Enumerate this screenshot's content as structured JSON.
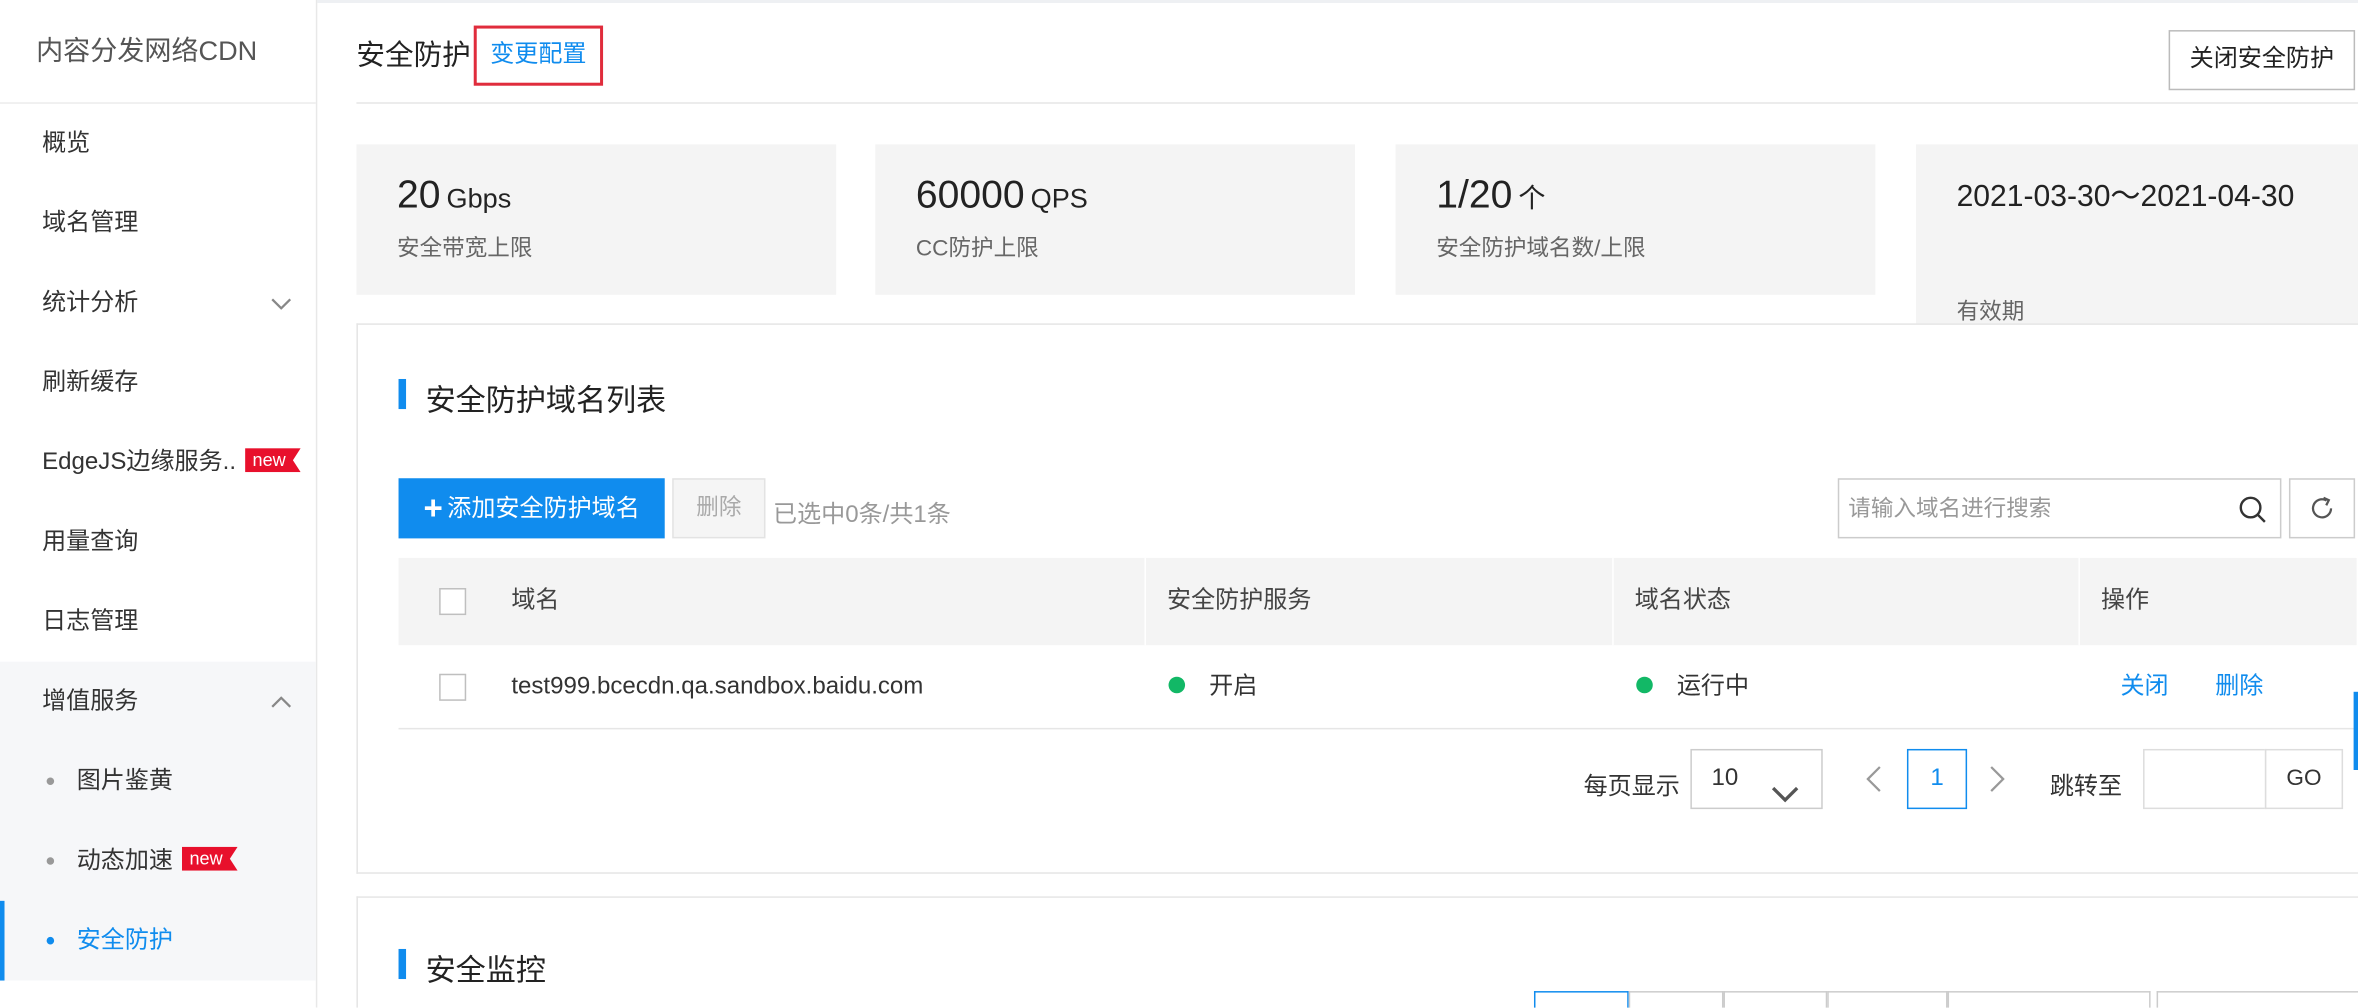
{
  "sidebar": {
    "brand": "内容分发网络CDN",
    "items": [
      {
        "label": "概览"
      },
      {
        "label": "域名管理"
      },
      {
        "label": "统计分析"
      },
      {
        "label": "刷新缓存"
      },
      {
        "label": "EdgeJS边缘服务..",
        "badge": "new"
      },
      {
        "label": "用量查询"
      },
      {
        "label": "日志管理"
      },
      {
        "label": "增值服务"
      }
    ],
    "sub_items": [
      {
        "label": "图片鉴黄"
      },
      {
        "label": "动态加速",
        "badge": "new"
      },
      {
        "label": "安全防护"
      }
    ]
  },
  "header": {
    "title": "安全防护",
    "change_config": "变更配置",
    "close_protect": "关闭安全防护"
  },
  "stats": [
    {
      "value": "20",
      "unit": "Gbps",
      "label": "安全带宽上限"
    },
    {
      "value": "60000",
      "unit": "QPS",
      "label": "CC防护上限"
    },
    {
      "value": "1/20",
      "unit": "个",
      "label": "安全防护域名数/上限"
    },
    {
      "value": "2021-03-30～2021-04-30",
      "unit": "",
      "label": "有效期"
    }
  ],
  "domain_list": {
    "title": "安全防护域名列表",
    "add_button": "添加安全防护域名",
    "add_icon": "plus-icon",
    "delete_button": "删除",
    "selection_info": "已选中0条/共1条",
    "search_placeholder": "请输入域名进行搜索",
    "columns": [
      "域名",
      "安全防护服务",
      "域名状态",
      "操作"
    ],
    "rows": [
      {
        "domain": "test999.bcecdn.qa.sandbox.baidu.com",
        "service": "开启",
        "status": "运行中",
        "actions": [
          "关闭",
          "删除"
        ]
      }
    ],
    "status_color": "#12b866"
  },
  "pagination": {
    "page_size_label": "每页显示",
    "page_size": "10",
    "current_page": "1",
    "jump_label": "跳转至",
    "go_label": "GO"
  },
  "monitor": {
    "title": "安全监控"
  },
  "colors": {
    "accent": "#108cee",
    "badge": "#e8102c",
    "highlight_border": "#e02c3c"
  }
}
